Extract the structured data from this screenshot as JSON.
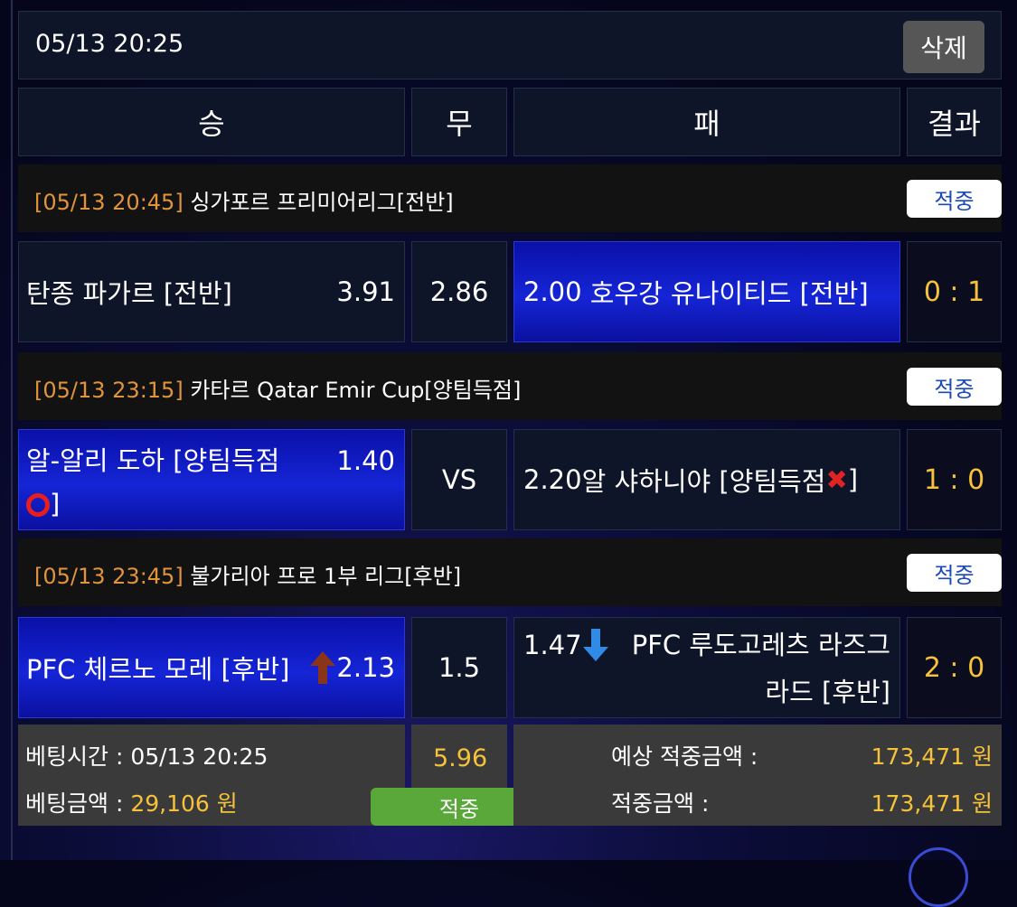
{
  "topbar": {
    "datetime": "05/13 20:25",
    "delete_label": "삭제"
  },
  "header": {
    "win": "승",
    "draw": "무",
    "lose": "패",
    "result": "결과"
  },
  "matches": [
    {
      "time": "[05/13 20:45]",
      "league": " 싱가포르 프리미어리그[전반]",
      "badge": "적중",
      "home": "탄종 파가르 [전반]",
      "home_odds": "3.91",
      "draw": "2.86",
      "away_odds": "2.00",
      "away": "호우강 유나이티드 [전반]",
      "result": "0 : 1"
    },
    {
      "time": "[05/13 23:15]",
      "league": " 카타르 Qatar Emir Cup[양팀득점]",
      "badge": "적중",
      "home": "알-알리 도하 [양팀득점",
      "home_suffix": "]",
      "home_odds": "1.40",
      "draw": "VS",
      "away_odds": "2.20",
      "away": "알 샤하니야 [양팀득점",
      "away_suffix": "]",
      "result": "1 : 0"
    },
    {
      "time": "[05/13 23:45]",
      "league": " 불가리아 프로 1부 리그[후반]",
      "badge": "적중",
      "home": "PFC 체르노 모레 [후반]",
      "home_odds": "2.13",
      "draw": "1.5",
      "away_odds": "1.47",
      "away": "PFC 루도고레츠 라즈그라드 [후반]",
      "result": "2 : 0"
    }
  ],
  "summary": {
    "bet_time_label": "베팅시간 : 05/13 20:25",
    "bet_amount_label": "베팅금액 : ",
    "bet_amount_value": "29,106 원",
    "total_odds": "5.96",
    "status": "적중",
    "expected_label": "예상 적중금액 :",
    "expected_value": "173,471 원",
    "hit_label": "적중금액 :",
    "hit_value": "173,471 원"
  },
  "colors": {
    "selected": "#1525d6",
    "result": "#f5c23a",
    "time": "#e1943c",
    "hit_green": "#5aa73a"
  },
  "icons": [
    "circle-o-icon",
    "cross-mark-icon",
    "arrow-up-icon",
    "arrow-down-icon"
  ]
}
